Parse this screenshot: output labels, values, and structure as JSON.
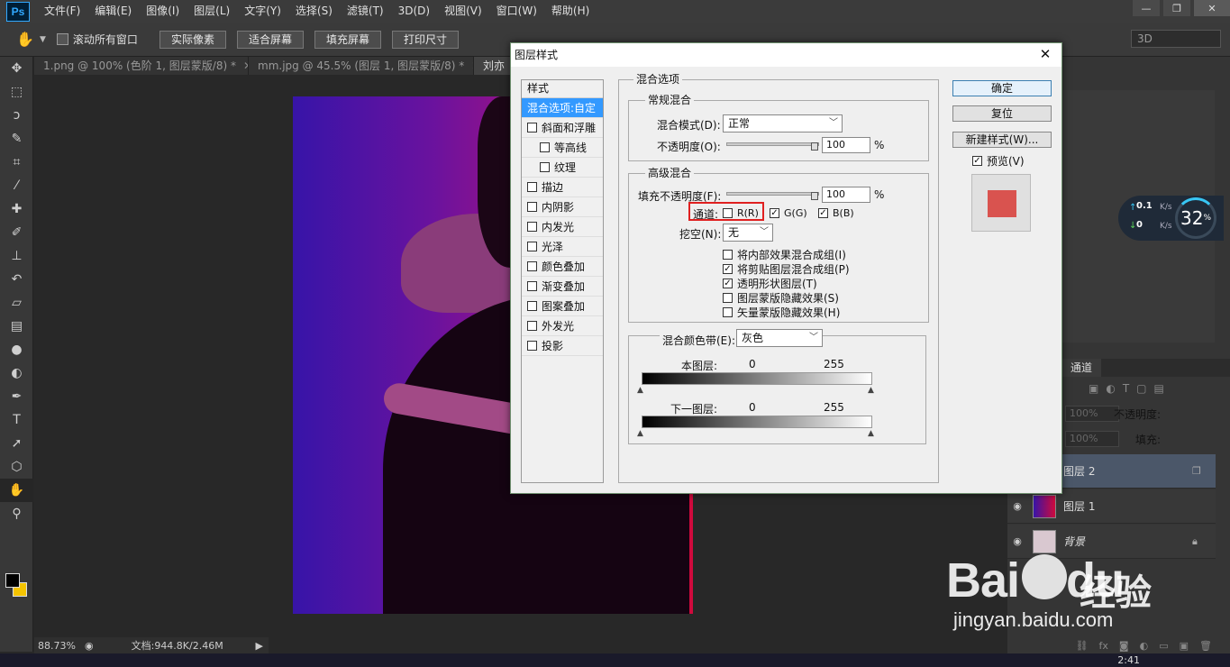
{
  "app": {
    "logo": "Ps",
    "menu": [
      "文件(F)",
      "编辑(E)",
      "图像(I)",
      "图层(L)",
      "文字(Y)",
      "选择(S)",
      "滤镜(T)",
      "3D(D)",
      "视图(V)",
      "窗口(W)",
      "帮助(H)"
    ]
  },
  "options": {
    "scroll_all_label": "滚动所有窗口",
    "buttons": [
      "实际像素",
      "适合屏幕",
      "填充屏幕",
      "打印尺寸"
    ],
    "workspace": "3D"
  },
  "tabs": [
    {
      "label": "1.png @ 100% (色阶 1, 图层蒙版/8) *"
    },
    {
      "label": "mm.jpg @ 45.5% (图层 1, 图层蒙版/8) *"
    },
    {
      "label": "刘亦"
    }
  ],
  "status": {
    "zoom": "88.73%",
    "doc": "文档:944.8K/2.46M"
  },
  "clock": "2:41",
  "network": {
    "up": "0.1",
    "down": "0",
    "unit": "K/s",
    "percent": "32",
    "percent_sign": "%"
  },
  "layers": {
    "channels_tab": "通道",
    "opacity_label": "不透明度:",
    "opacity_value": "100%",
    "fill_label": "填充:",
    "fill_value": "100%",
    "rows": [
      {
        "name": "图层 2",
        "selected": true,
        "thumb": "#ffffff"
      },
      {
        "name": "图层 1",
        "selected": false,
        "thumb": "#6a129e"
      },
      {
        "name": "背景",
        "selected": false,
        "thumb": "#d9c8d0"
      }
    ]
  },
  "watermark": {
    "brand": "Bai",
    "brand2": "du",
    "cn": "经验",
    "url": "jingyan.baidu.com"
  },
  "dialog": {
    "title": "图层样式",
    "style_header": "样式",
    "styles": [
      {
        "label": "混合选项:自定",
        "active": true,
        "check": false,
        "sub": false
      },
      {
        "label": "斜面和浮雕",
        "active": false,
        "check": true,
        "sub": false
      },
      {
        "label": "等高线",
        "active": false,
        "check": true,
        "sub": true
      },
      {
        "label": "纹理",
        "active": false,
        "check": true,
        "sub": true
      },
      {
        "label": "描边",
        "active": false,
        "check": true,
        "sub": false
      },
      {
        "label": "内阴影",
        "active": false,
        "check": true,
        "sub": false
      },
      {
        "label": "内发光",
        "active": false,
        "check": true,
        "sub": false
      },
      {
        "label": "光泽",
        "active": false,
        "check": true,
        "sub": false
      },
      {
        "label": "颜色叠加",
        "active": false,
        "check": true,
        "sub": false
      },
      {
        "label": "渐变叠加",
        "active": false,
        "check": true,
        "sub": false
      },
      {
        "label": "图案叠加",
        "active": false,
        "check": true,
        "sub": false
      },
      {
        "label": "外发光",
        "active": false,
        "check": true,
        "sub": false
      },
      {
        "label": "投影",
        "active": false,
        "check": true,
        "sub": false
      }
    ],
    "blend_options_title": "混合选项",
    "general_title": "常规混合",
    "blend_mode_label": "混合模式(D):",
    "blend_mode_value": "正常",
    "opacity_label": "不透明度(O):",
    "opacity_value": "100",
    "percent": "%",
    "advanced_title": "高级混合",
    "fill_opacity_label": "填充不透明度(F):",
    "fill_opacity_value": "100",
    "channels_label": "通道:",
    "channel_r": "R(R)",
    "channel_g": "G(G)",
    "channel_b": "B(B)",
    "knockout_label": "挖空(N):",
    "knockout_value": "无",
    "adv_checks": [
      {
        "label": "将内部效果混合成组(I)",
        "checked": false
      },
      {
        "label": "将剪贴图层混合成组(P)",
        "checked": true
      },
      {
        "label": "透明形状图层(T)",
        "checked": true
      },
      {
        "label": "图层蒙版隐藏效果(S)",
        "checked": false
      },
      {
        "label": "矢量蒙版隐藏效果(H)",
        "checked": false
      }
    ],
    "blend_if_label": "混合颜色带(E):",
    "blend_if_value": "灰色",
    "this_layer_label": "本图层:",
    "this_layer_min": "0",
    "this_layer_max": "255",
    "underlying_label": "下一图层:",
    "underlying_min": "0",
    "underlying_max": "255",
    "ok": "确定",
    "reset": "复位",
    "new_style": "新建样式(W)...",
    "preview": "预览(V)",
    "preview_color": "#d9534f"
  }
}
